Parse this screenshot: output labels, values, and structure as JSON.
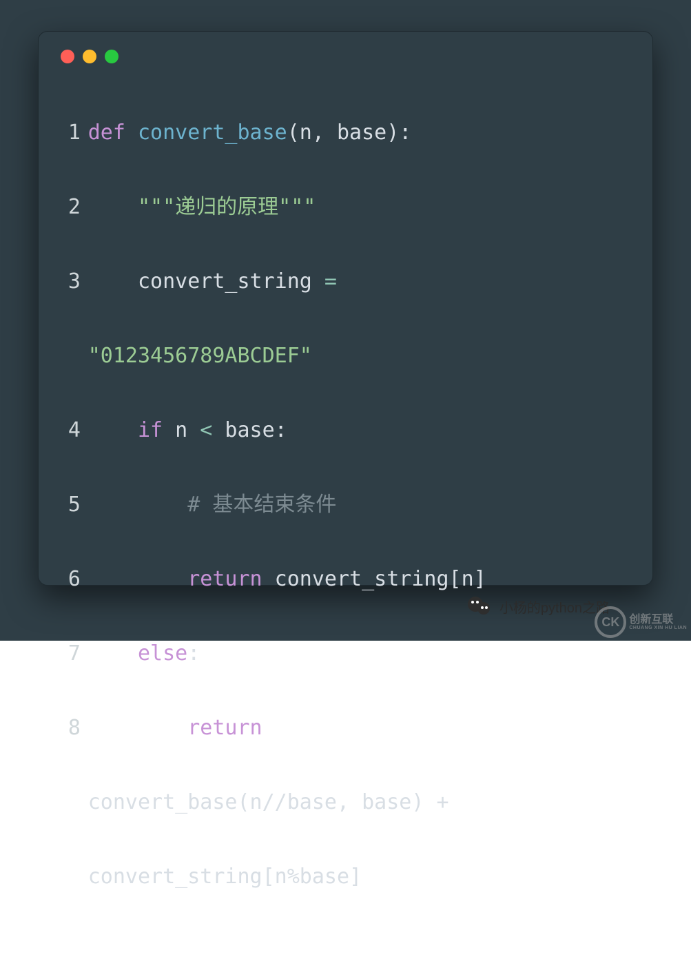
{
  "window": {
    "dots": [
      "red",
      "yellow",
      "green"
    ]
  },
  "code": {
    "l1_def": "def",
    "l1_fn": "convert_base",
    "l1_open": "(",
    "l1_args": "n, base",
    "l1_close": "):",
    "l2_doc": "\"\"\"递归的原理\"\"\"",
    "l3_lhs": "convert_string",
    "l3_eq": " = ",
    "l3b_str": "\"0123456789ABCDEF\"",
    "l4_if": "if",
    "l4_n": " n ",
    "l4_lt": "<",
    "l4_base": " base",
    "l4_colon": ":",
    "l5_cmt": "# 基本结束条件",
    "l6_ret": "return",
    "l6_rest": " convert_string[n]",
    "l7_else": "else",
    "l7_colon": ":",
    "l8_ret": "return",
    "l8b": "convert_base(n//base, base) + ",
    "l8c": "convert_string[n%base]",
    "ln1": "1",
    "ln2": "2",
    "ln3": "3",
    "ln4": "4",
    "ln5": "5",
    "ln6": "6",
    "ln7": "7",
    "ln8": "8"
  },
  "footer": {
    "text": "小杨的python之路"
  },
  "watermark": {
    "brand_short": "CK",
    "brand_cn": "创新互联",
    "brand_py": "CHUANG XIN HU LIAN"
  }
}
